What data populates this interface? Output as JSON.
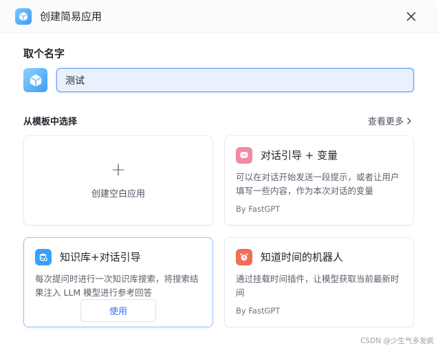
{
  "header": {
    "title": "创建简易应用",
    "logo_icon": "cube-icon",
    "close_icon": "close-icon"
  },
  "name_section": {
    "label": "取个名字",
    "avatar_icon": "cube-icon",
    "input_value": "测试"
  },
  "templates": {
    "label": "从模板中选择",
    "see_more": "查看更多",
    "empty_card": {
      "plus": "+",
      "label": "创建空白应用"
    },
    "cards": [
      {
        "title": "对话引导 + 变量",
        "description": "可以在对话开始发送一段提示，或者让用户填写一些内容，作为本次对话的变量",
        "author": "By FastGPT",
        "icon": "chat-bubble-icon",
        "icon_color": "#f28aa3"
      },
      {
        "title": "知识库+对话引导",
        "description": "每次提问时进行一次知识库搜索，将搜索结果注入 LLM 模型进行参考回答",
        "use_label": "使用",
        "icon": "database-icon",
        "icon_color": "#3aa0f5"
      },
      {
        "title": "知道时间的机器人",
        "description": "通过挂载时间插件，让模型获取当前最新时间",
        "author": "By FastGPT",
        "icon": "alarm-clock-icon",
        "icon_color": "#f06e55"
      }
    ]
  },
  "watermark": "CSDN @少生气多发疯",
  "colors": {
    "accent": "#3370ff",
    "input_border": "#5f95f7",
    "input_bg": "#eaf1fe"
  }
}
